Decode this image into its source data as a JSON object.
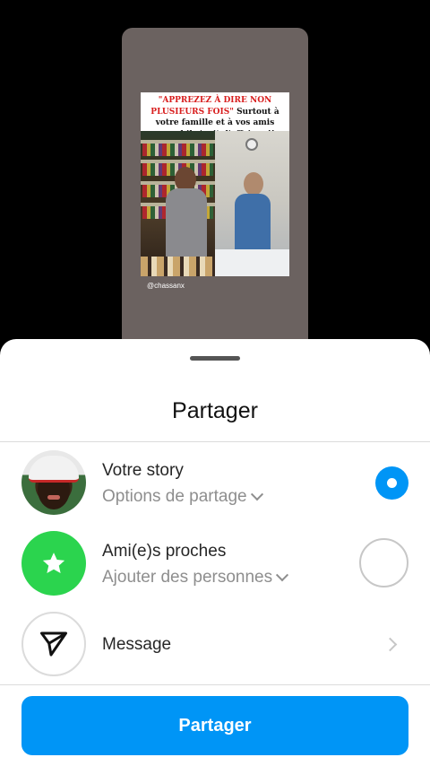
{
  "preview": {
    "caption_red": "\"APPREZEZ À DIRE NON PLUSIEURS FOIS\"",
    "caption_black": "Surtout à votre famille et à vos amis quand il s'agit d'affaires !!",
    "handle": "@chassanx"
  },
  "sheet": {
    "title": "Partager",
    "options": [
      {
        "title": "Votre story",
        "subtitle": "Options de partage",
        "selected": true,
        "icon": "profile-photo"
      },
      {
        "title": "Ami(e)s proches",
        "subtitle": "Ajouter des personnes",
        "selected": false,
        "icon": "star-icon",
        "icon_color": "#2bd44e"
      },
      {
        "title": "Message",
        "icon": "paper-plane-icon"
      }
    ],
    "share_button": "Partager",
    "accent_color": "#0095f6"
  }
}
